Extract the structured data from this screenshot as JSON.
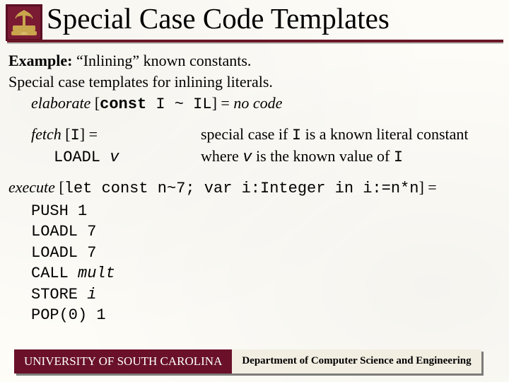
{
  "title": "Special Case Code Templates",
  "example_label": "Example:",
  "example_text": " “Inlining” known constants.",
  "line_templates": "Special case templates for inlining literals.",
  "elaborate_word": "elaborate",
  "elab_open": " [",
  "elab_const": "const",
  "elab_mid": " I ~ IL",
  "elab_close": "] = ",
  "elab_result": "no code",
  "fetch_word": "fetch",
  "fetch_open": " [",
  "fetch_I": "I",
  "fetch_close": "] =",
  "loadl_word": "LOADL ",
  "loadl_v": "v",
  "sc_1a": "special case if ",
  "sc_1b": "I",
  "sc_1c": " is a known literal constant",
  "sc_2a": "where ",
  "sc_2b": "v",
  "sc_2c": " is the known value of ",
  "sc_2d": "I",
  "exec_word": "execute",
  "exec_open": " [",
  "exec_code": "let const n~7; var i:Integer in i:=n*n",
  "exec_close": "] =",
  "code1a": "PUSH  ",
  "code1b": "1",
  "code2a": "LOADL  ",
  "code2b": "7",
  "code3a": "LOADL  ",
  "code3b": "7",
  "code4a": "CALL  ",
  "code4b": "mult",
  "code5a": "STORE ",
  "code5b": "i",
  "code6a": "POP(0) ",
  "code6b": "1",
  "footer_left": "UNIVERSITY OF SOUTH CAROLINA",
  "footer_right": "Department of Computer Science and Engineering"
}
